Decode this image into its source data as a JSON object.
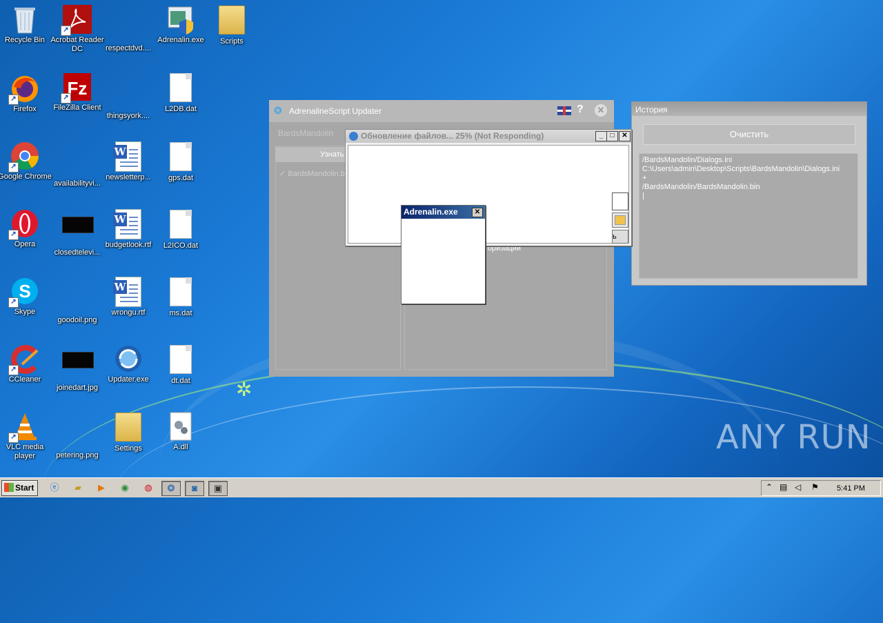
{
  "desktop": {
    "icons": [
      {
        "label": "Recycle Bin"
      },
      {
        "label": "Acrobat Reader DC"
      },
      {
        "label": "respectdvd...."
      },
      {
        "label": "Adrenalin.exe"
      },
      {
        "label": "Scripts"
      },
      {
        "label": "Firefox"
      },
      {
        "label": "FileZilla Client"
      },
      {
        "label": "thingsyork...."
      },
      {
        "label": "L2DB.dat"
      },
      {
        "label": "Google Chrome"
      },
      {
        "label": "availabilityvi..."
      },
      {
        "label": "newsletterp..."
      },
      {
        "label": "gps.dat"
      },
      {
        "label": "Opera"
      },
      {
        "label": "closedtelevi..."
      },
      {
        "label": "budgetlook.rtf"
      },
      {
        "label": "L2ICO.dat"
      },
      {
        "label": "Skype"
      },
      {
        "label": "goodoil.png"
      },
      {
        "label": "wrongu.rtf"
      },
      {
        "label": "ms.dat"
      },
      {
        "label": "CCleaner"
      },
      {
        "label": "joinedart.jpg"
      },
      {
        "label": "Updater.exe"
      },
      {
        "label": "dt.dat"
      },
      {
        "label": "VLC media player"
      },
      {
        "label": "petering.png"
      },
      {
        "label": "Settings"
      },
      {
        "label": "A.dll"
      }
    ]
  },
  "updater": {
    "title": "AdrenalineScript Updater",
    "subtitle": "BardsMandolin",
    "button": "Узнать по",
    "list_item": "BardsMandolin.bi",
    "auth_text": "торизации"
  },
  "progress_window": {
    "title": "Обновление файлов... 25% (Not Responding)",
    "progress_percent": 25,
    "side_label": "ь"
  },
  "adrenalin_window": {
    "title": "Adrenalin.exe"
  },
  "history": {
    "title": "История",
    "clear_label": "Очистить",
    "log_lines": [
      "/BardsMandolin/Dialogs.ini",
      "C:\\Users\\admin\\Desktop\\Scripts\\BardsMandolin\\Dialogs.ini",
      "+",
      "/BardsMandolin/BardsMandolin.bin",
      "|"
    ]
  },
  "watermark": "ANY RUN",
  "taskbar": {
    "start_label": "Start",
    "clock": "5:41 PM"
  }
}
